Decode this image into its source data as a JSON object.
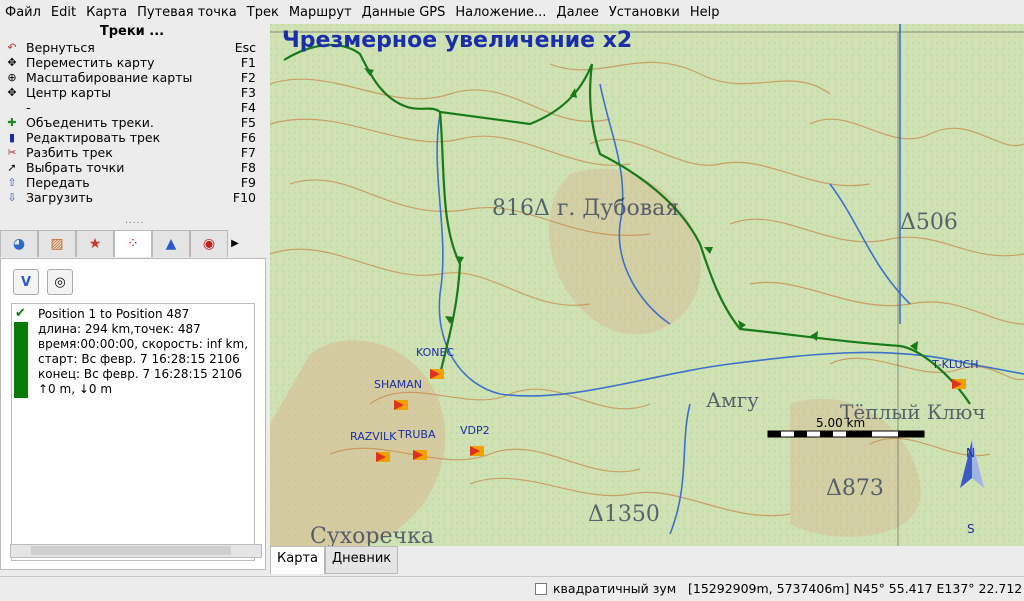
{
  "menu": [
    "Файл",
    "Edit",
    "Карта",
    "Путевая точка",
    "Трек",
    "Маршрут",
    "Данные GPS",
    "Наложение...",
    "Далее",
    "Установки",
    "Help"
  ],
  "panel": {
    "title": "Треки ...",
    "commands": [
      {
        "label": "Вернуться",
        "key": "Esc",
        "icon": "undo-icon"
      },
      {
        "label": "Переместить карту",
        "key": "F1",
        "icon": "move-icon"
      },
      {
        "label": "Масштабирование карты",
        "key": "F2",
        "icon": "zoom-icon"
      },
      {
        "label": "Центр карты",
        "key": "F3",
        "icon": "center-icon"
      },
      {
        "label": "-",
        "key": "F4",
        "icon": ""
      },
      {
        "label": "Объеденить треки.",
        "key": "F5",
        "icon": "join-icon"
      },
      {
        "label": "Редактировать трек",
        "key": "F6",
        "icon": "edit-icon"
      },
      {
        "label": "Разбить трек",
        "key": "F7",
        "icon": "cut-icon"
      },
      {
        "label": "Выбрать точки",
        "key": "F8",
        "icon": "select-points-icon"
      },
      {
        "label": "Передать",
        "key": "F9",
        "icon": "upload-icon"
      },
      {
        "label": "Загрузить",
        "key": "F10",
        "icon": "download-icon"
      }
    ]
  },
  "track": {
    "name": "Position 1 to Position 487",
    "length": "длина: 294 km,точек: 487",
    "time": "время:00:00:00, скорость: inf km,",
    "start": "старт: Вс февр. 7 16:28:15 2106",
    "end": "конец: Вс февр. 7 16:28:15 2106",
    "elevation": "↑0 m, ↓0 m",
    "color": "#0a7a0a"
  },
  "map": {
    "title": "Чрезмерное увеличение x2",
    "waypoints": [
      "KONEC",
      "SHAMAN",
      "RAZVILK",
      "TRUBA",
      "VDP2",
      "T-KLUCH"
    ],
    "map_labels": [
      "816Δ г. Дубовая",
      "Δ506",
      "Амгу",
      "Тёплый Ключ",
      "Δ873",
      "Δ1350",
      "Сухоречка"
    ],
    "scale": "5.00 km",
    "compass_n": "N",
    "compass_s": "S"
  },
  "map_tabs": [
    "Карта",
    "Дневник"
  ],
  "status": {
    "zoom_label": "квадратичный зум",
    "coords": "[15292909m, 5737406m] N45° 55.417 E137° 22.712"
  }
}
